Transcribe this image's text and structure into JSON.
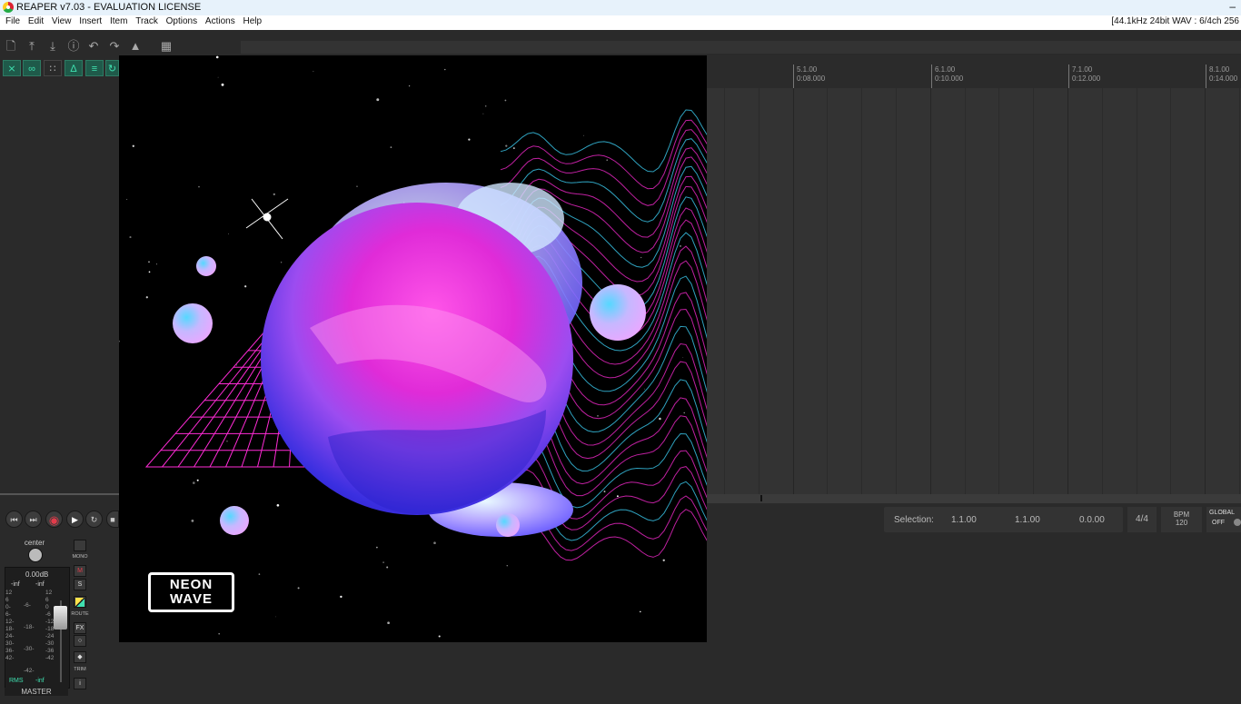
{
  "window": {
    "title": "REAPER v7.03 - EVALUATION LICENSE",
    "minimize_glyph": "–"
  },
  "menu": {
    "items": [
      "File",
      "Edit",
      "View",
      "Insert",
      "Item",
      "Track",
      "Options",
      "Actions",
      "Help"
    ],
    "audio_info": "[44.1kHz 24bit WAV : 6/4ch 256"
  },
  "toolbar": {
    "icons": [
      "new-project-icon",
      "open-project-icon",
      "save-project-icon",
      "project-info-icon",
      "undo-icon",
      "redo-icon",
      "metronome-icon",
      "grid-icon"
    ],
    "toggle_icons": [
      "ripple-edit-icon",
      "link-icon",
      "grid-snap-icon",
      "auto-crossfade-icon",
      "envelope-icon",
      "loop-icon"
    ]
  },
  "ruler": {
    "markers": [
      {
        "bar": "5.1.00",
        "time": "0:08.000"
      },
      {
        "bar": "6.1.00",
        "time": "0:10.000"
      },
      {
        "bar": "7.1.00",
        "time": "0:12.000"
      },
      {
        "bar": "8.1.00",
        "time": "0:14.000"
      }
    ]
  },
  "transport": {
    "buttons": [
      "go-to-start",
      "go-to-end",
      "record",
      "play",
      "repeat",
      "stop"
    ],
    "selection_label": "Selection:",
    "selection_start": "1.1.00",
    "selection_end": "1.1.00",
    "selection_length": "0.0.00",
    "time_signature": "4/4",
    "bpm_label": "BPM",
    "bpm_value": "120",
    "global_label": "GLOBAL",
    "global_state": "OFF"
  },
  "master": {
    "pan": "center",
    "volume": "0.00dB",
    "peak_left": "-inf",
    "peak_right": "-inf",
    "scale_left": [
      "12",
      "6",
      "0-",
      "6-",
      "12-",
      "18-",
      "24-",
      "30-",
      "36-",
      "42-"
    ],
    "scale_mid_left": [
      "-6-",
      "-18-",
      "-30-",
      "-42-",
      "-54-"
    ],
    "scale_mid_right": [
      "12",
      "6",
      "0",
      "-6",
      "-12",
      "-18",
      "-24",
      "-30",
      "-36",
      "-42"
    ],
    "rms_label": "RMS",
    "rms_value": "-inf",
    "name": "MASTER",
    "mono_label": "MONO",
    "mute_label": "M",
    "solo_label": "S",
    "route_label": "ROUTE",
    "fx_label": "FX",
    "trim_label": "TRIM",
    "info_label": "i"
  },
  "albumart": {
    "logo_line1": "NEON",
    "logo_line2": "WAVE"
  },
  "colors": {
    "record": "#e23b4a",
    "play": "#ffffff",
    "toggle_accent": "#3fe0b0",
    "neon_pink": "#ff2bd6",
    "neon_cyan": "#3fd8ff"
  }
}
